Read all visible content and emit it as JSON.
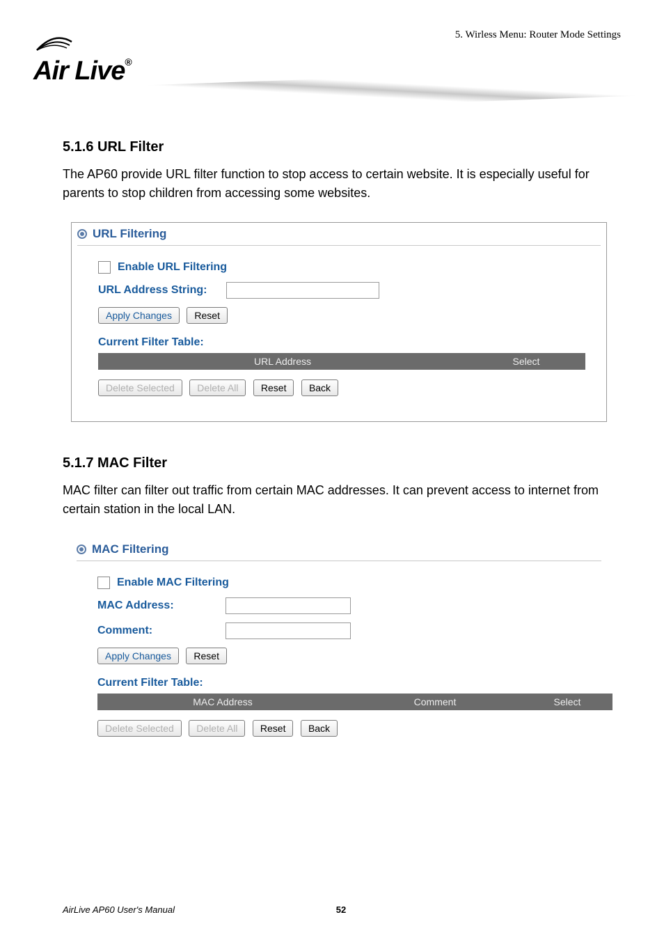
{
  "header": {
    "chapter": "5. Wirless Menu: Router Mode Settings",
    "logo_text": "Air Live",
    "logo_reg": "®"
  },
  "section_url": {
    "heading": "5.1.6 URL Filter",
    "paragraph": "The AP60 provide URL filter function to stop access to certain website.    It is especially useful for parents to stop children from accessing some websites.",
    "panel_title": "URL Filtering",
    "enable_label": "Enable URL Filtering",
    "addr_label": "URL Address String:",
    "apply": "Apply Changes",
    "reset": "Reset",
    "table_title": "Current Filter Table:",
    "col_url": "URL Address",
    "col_select": "Select",
    "del_sel": "Delete Selected",
    "del_all": "Delete All",
    "back": "Back"
  },
  "section_mac": {
    "heading": "5.1.7 MAC Filter",
    "paragraph": "MAC filter can filter out traffic from certain MAC addresses.    It can prevent access to internet from certain station in the local LAN.",
    "panel_title": "MAC Filtering",
    "enable_label": "Enable MAC Filtering",
    "mac_label": "MAC Address:",
    "comment_label": "Comment:",
    "apply": "Apply Changes",
    "reset": "Reset",
    "table_title": "Current Filter Table:",
    "col_mac": "MAC Address",
    "col_comment": "Comment",
    "col_select": "Select",
    "del_sel": "Delete Selected",
    "del_all": "Delete All",
    "back": "Back"
  },
  "footer": {
    "left": "AirLive AP60 User's Manual",
    "page": "52"
  }
}
